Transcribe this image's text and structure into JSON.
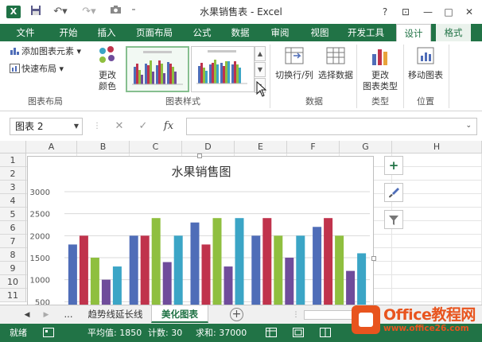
{
  "titlebar": {
    "logo": "X",
    "title": "水果销售表 - Excel",
    "qat_save": "save-icon",
    "qat_undo": "undo-icon",
    "qat_redo": "redo-icon",
    "qat_camera": "camera-icon",
    "help": "?",
    "restore": "⊡",
    "minimize": "—",
    "maximize": "□",
    "close": "✕"
  },
  "tabs": [
    {
      "label": "文件"
    },
    {
      "label": "开始"
    },
    {
      "label": "插入"
    },
    {
      "label": "页面布局"
    },
    {
      "label": "公式"
    },
    {
      "label": "数据"
    },
    {
      "label": "审阅"
    },
    {
      "label": "视图"
    },
    {
      "label": "开发工具"
    },
    {
      "label": "设计"
    },
    {
      "label": "格式"
    }
  ],
  "active_tab": "设计",
  "ribbon": {
    "add_element": "添加图表元素",
    "quick_layout": "快速布局",
    "change_colors": "更改\n颜色",
    "group_layout": "图表布局",
    "group_styles": "图表样式",
    "switch_row_col": "切换行/列",
    "select_data": "选择数据",
    "group_data": "数据",
    "change_type": "更改\n图表类型",
    "group_type": "类型",
    "move_chart": "移动图表",
    "group_location": "位置"
  },
  "formula_bar": {
    "name_box": "图表 2",
    "cancel": "✕",
    "enter": "✓",
    "fx": "fx",
    "value": ""
  },
  "columns": [
    "A",
    "B",
    "C",
    "D",
    "E",
    "F",
    "G",
    "H"
  ],
  "rows": [
    "1",
    "2",
    "3",
    "4",
    "5",
    "6",
    "7",
    "8",
    "9",
    "10",
    "11"
  ],
  "chart_data": {
    "type": "bar",
    "title": "水果销售图",
    "categories": [
      "",
      "",
      "",
      "",
      ""
    ],
    "series": [
      {
        "values": [
          1800,
          2000,
          2300,
          2000,
          2200
        ],
        "color": "#4f6db8"
      },
      {
        "values": [
          2000,
          2000,
          1800,
          2400,
          2400
        ],
        "color": "#c0334c"
      },
      {
        "values": [
          1500,
          2400,
          2400,
          2000,
          2000
        ],
        "color": "#8fbf3f"
      },
      {
        "values": [
          1000,
          1400,
          1300,
          1500,
          1200
        ],
        "color": "#6f4c9b"
      },
      {
        "values": [
          1300,
          2000,
          2400,
          2000,
          1600
        ],
        "color": "#3ba5c6"
      }
    ],
    "yticks": [
      "3000",
      "2500",
      "2000",
      "1500",
      "1000",
      "500"
    ],
    "ylim": [
      300,
      3000
    ],
    "grid": true,
    "legend": "none"
  },
  "sheets": {
    "more": "...",
    "tab1": "趋势线延长线",
    "tab2": "美化图表",
    "add": "+"
  },
  "status": {
    "ready": "就绪",
    "average": "平均值: 1850",
    "count": "计数: 30",
    "sum": "求和: 37000"
  },
  "watermark": {
    "title": "Office教程网",
    "url": "www.office26.com"
  },
  "colors": {
    "excel_green": "#217346",
    "watermark_orange": "#e8541e"
  }
}
